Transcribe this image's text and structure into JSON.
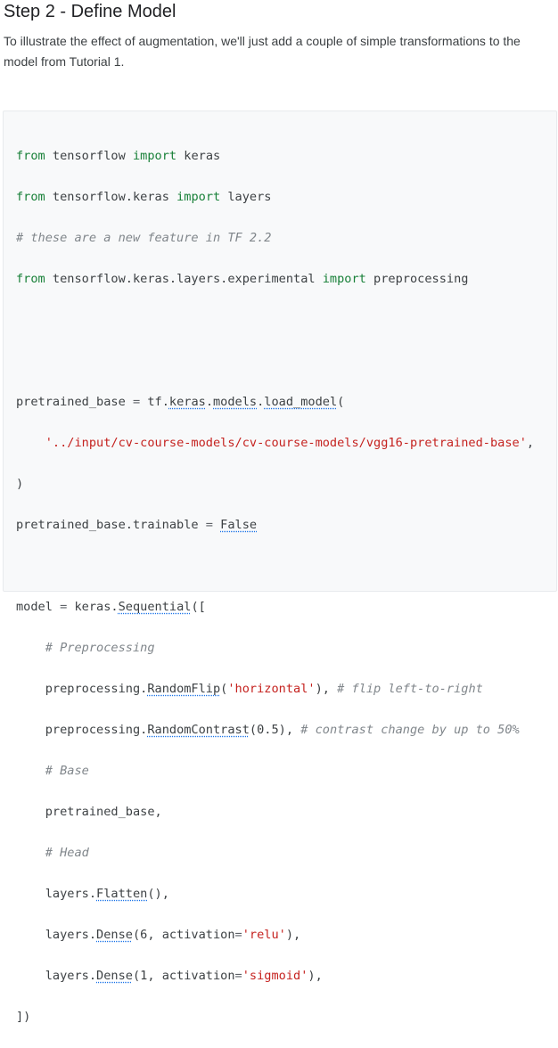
{
  "heading": "Step 2 - Define Model",
  "intro": "To illustrate the effect of augmentation, we'll just add a couple of simple transformations to the model from Tutorial 1.",
  "code": {
    "l1": {
      "a": "from",
      "b": " tensorflow ",
      "c": "import",
      "d": " keras"
    },
    "l2": {
      "a": "from",
      "b": " tensorflow.keras ",
      "c": "import",
      "d": " layers"
    },
    "l3": "# these are a new feature in TF 2.2",
    "l4": {
      "a": "from",
      "b": " tensorflow.keras.layers.experimental ",
      "c": "import",
      "d": " preprocessing"
    },
    "l7": {
      "a": "pretrained_base ",
      "b": "=",
      "c": " tf.",
      "d": "keras",
      "e": ".",
      "f": "models",
      "g": ".",
      "h": "load_model",
      "i": "("
    },
    "l8": {
      "indent": "    ",
      "str": "'../input/cv-course-models/cv-course-models/vgg16-pretrained-base'",
      "tail": ","
    },
    "l9": ")",
    "l10": {
      "a": "pretrained_base.trainable ",
      "b": "=",
      "c": " ",
      "d": "False"
    },
    "l12": {
      "a": "model ",
      "b": "=",
      "c": " keras.",
      "d": "Sequential",
      "e": "(["
    },
    "l13": "    # Preprocessing",
    "l14": {
      "a": "    preprocessing.",
      "b": "RandomFlip",
      "c": "(",
      "d": "'horizontal'",
      "e": "), ",
      "f": "# flip left-to-right"
    },
    "l15": {
      "a": "    preprocessing.",
      "b": "RandomContrast",
      "c": "(0.5), ",
      "d": "# contrast change by up to 50%"
    },
    "l16": "    # Base",
    "l17": "    pretrained_base,",
    "l18": "    # Head",
    "l19": {
      "a": "    layers.",
      "b": "Flatten",
      "c": "(),"
    },
    "l20": {
      "a": "    layers.",
      "b": "Dense",
      "c": "(6, activation",
      "d": "=",
      "e": "'relu'",
      "f": "),"
    },
    "l21": {
      "a": "    layers.",
      "b": "Dense",
      "c": "(1, activation",
      "d": "=",
      "e": "'sigmoid'",
      "f": "),"
    },
    "l22": "])"
  }
}
